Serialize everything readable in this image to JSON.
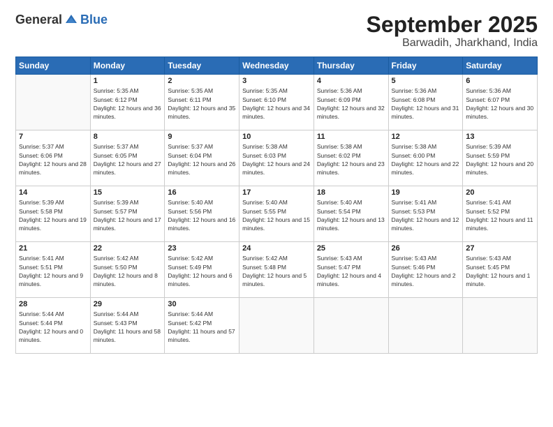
{
  "logo": {
    "general": "General",
    "blue": "Blue"
  },
  "header": {
    "month": "September 2025",
    "location": "Barwadih, Jharkhand, India"
  },
  "days": [
    "Sunday",
    "Monday",
    "Tuesday",
    "Wednesday",
    "Thursday",
    "Friday",
    "Saturday"
  ],
  "weeks": [
    [
      {
        "num": "",
        "sunrise": "",
        "sunset": "",
        "daylight": ""
      },
      {
        "num": "1",
        "sunrise": "Sunrise: 5:35 AM",
        "sunset": "Sunset: 6:12 PM",
        "daylight": "Daylight: 12 hours and 36 minutes."
      },
      {
        "num": "2",
        "sunrise": "Sunrise: 5:35 AM",
        "sunset": "Sunset: 6:11 PM",
        "daylight": "Daylight: 12 hours and 35 minutes."
      },
      {
        "num": "3",
        "sunrise": "Sunrise: 5:35 AM",
        "sunset": "Sunset: 6:10 PM",
        "daylight": "Daylight: 12 hours and 34 minutes."
      },
      {
        "num": "4",
        "sunrise": "Sunrise: 5:36 AM",
        "sunset": "Sunset: 6:09 PM",
        "daylight": "Daylight: 12 hours and 32 minutes."
      },
      {
        "num": "5",
        "sunrise": "Sunrise: 5:36 AM",
        "sunset": "Sunset: 6:08 PM",
        "daylight": "Daylight: 12 hours and 31 minutes."
      },
      {
        "num": "6",
        "sunrise": "Sunrise: 5:36 AM",
        "sunset": "Sunset: 6:07 PM",
        "daylight": "Daylight: 12 hours and 30 minutes."
      }
    ],
    [
      {
        "num": "7",
        "sunrise": "Sunrise: 5:37 AM",
        "sunset": "Sunset: 6:06 PM",
        "daylight": "Daylight: 12 hours and 28 minutes."
      },
      {
        "num": "8",
        "sunrise": "Sunrise: 5:37 AM",
        "sunset": "Sunset: 6:05 PM",
        "daylight": "Daylight: 12 hours and 27 minutes."
      },
      {
        "num": "9",
        "sunrise": "Sunrise: 5:37 AM",
        "sunset": "Sunset: 6:04 PM",
        "daylight": "Daylight: 12 hours and 26 minutes."
      },
      {
        "num": "10",
        "sunrise": "Sunrise: 5:38 AM",
        "sunset": "Sunset: 6:03 PM",
        "daylight": "Daylight: 12 hours and 24 minutes."
      },
      {
        "num": "11",
        "sunrise": "Sunrise: 5:38 AM",
        "sunset": "Sunset: 6:02 PM",
        "daylight": "Daylight: 12 hours and 23 minutes."
      },
      {
        "num": "12",
        "sunrise": "Sunrise: 5:38 AM",
        "sunset": "Sunset: 6:00 PM",
        "daylight": "Daylight: 12 hours and 22 minutes."
      },
      {
        "num": "13",
        "sunrise": "Sunrise: 5:39 AM",
        "sunset": "Sunset: 5:59 PM",
        "daylight": "Daylight: 12 hours and 20 minutes."
      }
    ],
    [
      {
        "num": "14",
        "sunrise": "Sunrise: 5:39 AM",
        "sunset": "Sunset: 5:58 PM",
        "daylight": "Daylight: 12 hours and 19 minutes."
      },
      {
        "num": "15",
        "sunrise": "Sunrise: 5:39 AM",
        "sunset": "Sunset: 5:57 PM",
        "daylight": "Daylight: 12 hours and 17 minutes."
      },
      {
        "num": "16",
        "sunrise": "Sunrise: 5:40 AM",
        "sunset": "Sunset: 5:56 PM",
        "daylight": "Daylight: 12 hours and 16 minutes."
      },
      {
        "num": "17",
        "sunrise": "Sunrise: 5:40 AM",
        "sunset": "Sunset: 5:55 PM",
        "daylight": "Daylight: 12 hours and 15 minutes."
      },
      {
        "num": "18",
        "sunrise": "Sunrise: 5:40 AM",
        "sunset": "Sunset: 5:54 PM",
        "daylight": "Daylight: 12 hours and 13 minutes."
      },
      {
        "num": "19",
        "sunrise": "Sunrise: 5:41 AM",
        "sunset": "Sunset: 5:53 PM",
        "daylight": "Daylight: 12 hours and 12 minutes."
      },
      {
        "num": "20",
        "sunrise": "Sunrise: 5:41 AM",
        "sunset": "Sunset: 5:52 PM",
        "daylight": "Daylight: 12 hours and 11 minutes."
      }
    ],
    [
      {
        "num": "21",
        "sunrise": "Sunrise: 5:41 AM",
        "sunset": "Sunset: 5:51 PM",
        "daylight": "Daylight: 12 hours and 9 minutes."
      },
      {
        "num": "22",
        "sunrise": "Sunrise: 5:42 AM",
        "sunset": "Sunset: 5:50 PM",
        "daylight": "Daylight: 12 hours and 8 minutes."
      },
      {
        "num": "23",
        "sunrise": "Sunrise: 5:42 AM",
        "sunset": "Sunset: 5:49 PM",
        "daylight": "Daylight: 12 hours and 6 minutes."
      },
      {
        "num": "24",
        "sunrise": "Sunrise: 5:42 AM",
        "sunset": "Sunset: 5:48 PM",
        "daylight": "Daylight: 12 hours and 5 minutes."
      },
      {
        "num": "25",
        "sunrise": "Sunrise: 5:43 AM",
        "sunset": "Sunset: 5:47 PM",
        "daylight": "Daylight: 12 hours and 4 minutes."
      },
      {
        "num": "26",
        "sunrise": "Sunrise: 5:43 AM",
        "sunset": "Sunset: 5:46 PM",
        "daylight": "Daylight: 12 hours and 2 minutes."
      },
      {
        "num": "27",
        "sunrise": "Sunrise: 5:43 AM",
        "sunset": "Sunset: 5:45 PM",
        "daylight": "Daylight: 12 hours and 1 minute."
      }
    ],
    [
      {
        "num": "28",
        "sunrise": "Sunrise: 5:44 AM",
        "sunset": "Sunset: 5:44 PM",
        "daylight": "Daylight: 12 hours and 0 minutes."
      },
      {
        "num": "29",
        "sunrise": "Sunrise: 5:44 AM",
        "sunset": "Sunset: 5:43 PM",
        "daylight": "Daylight: 11 hours and 58 minutes."
      },
      {
        "num": "30",
        "sunrise": "Sunrise: 5:44 AM",
        "sunset": "Sunset: 5:42 PM",
        "daylight": "Daylight: 11 hours and 57 minutes."
      },
      {
        "num": "",
        "sunrise": "",
        "sunset": "",
        "daylight": ""
      },
      {
        "num": "",
        "sunrise": "",
        "sunset": "",
        "daylight": ""
      },
      {
        "num": "",
        "sunrise": "",
        "sunset": "",
        "daylight": ""
      },
      {
        "num": "",
        "sunrise": "",
        "sunset": "",
        "daylight": ""
      }
    ]
  ]
}
